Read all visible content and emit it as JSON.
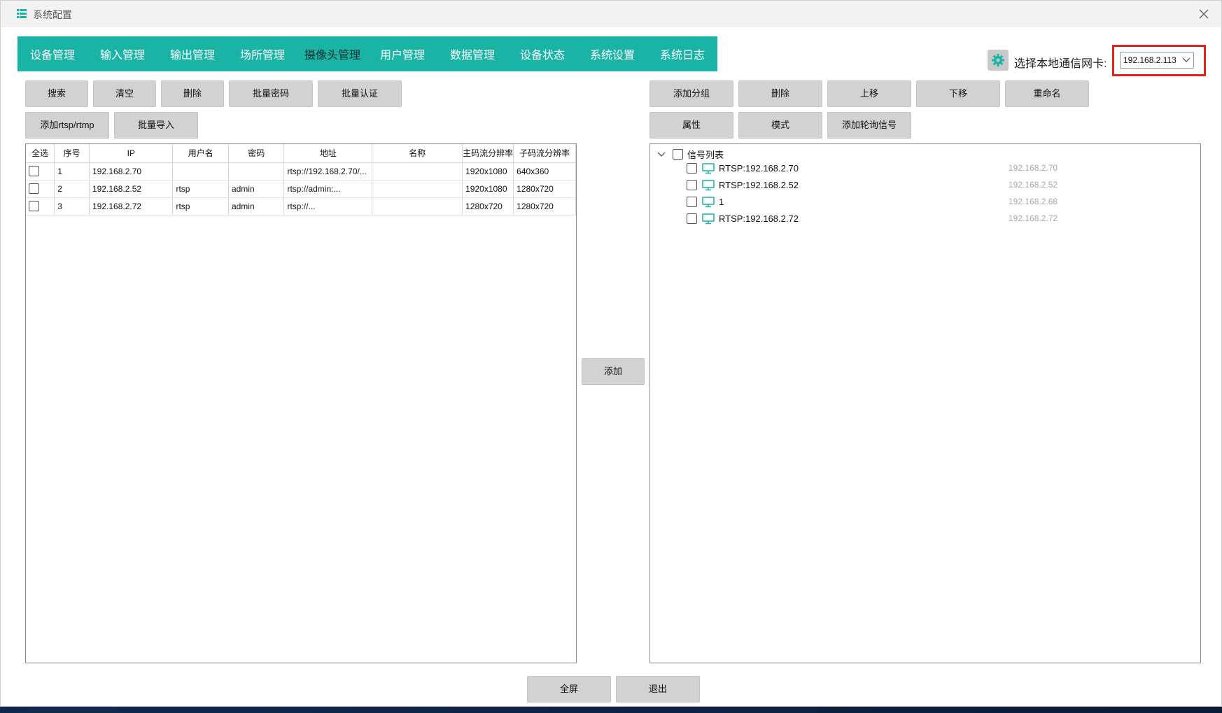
{
  "window": {
    "title": "系统配置"
  },
  "tabs": [
    "设备管理",
    "输入管理",
    "输出管理",
    "场所管理",
    "摄像头管理",
    "用户管理",
    "数据管理",
    "设备状态",
    "系统设置",
    "系统日志"
  ],
  "nic": {
    "label": "选择本地通信网卡:",
    "selected": "192.168.2.113"
  },
  "left_toolbar": {
    "row1": [
      "搜索",
      "清空",
      "删除",
      "批量密码",
      "批量认证"
    ],
    "row2": [
      "添加rtsp/rtmp",
      "批量导入"
    ]
  },
  "right_toolbar": {
    "row1": [
      "添加分组",
      "删除",
      "上移",
      "下移",
      "重命名"
    ],
    "row2": [
      "属性",
      "模式",
      "添加轮询信号"
    ]
  },
  "camera_table": {
    "headers": [
      "全选",
      "序号",
      "IP",
      "用户名",
      "密码",
      "地址",
      "名称",
      "主码流分辨率",
      "子码流分辨率"
    ],
    "rows": [
      {
        "index": "1",
        "ip": "192.168.2.70",
        "user": "",
        "password": "",
        "address": "rtsp://192.168.2.70/...",
        "name": "",
        "main_res": "1920x1080",
        "sub_res": "640x360"
      },
      {
        "index": "2",
        "ip": "192.168.2.52",
        "user": "rtsp",
        "password": "admin",
        "address": "rtsp://admin:...",
        "name": "",
        "main_res": "1920x1080",
        "sub_res": "1280x720"
      },
      {
        "index": "3",
        "ip": "192.168.2.72",
        "user": "rtsp",
        "password": "admin",
        "address": "rtsp://...",
        "name": "",
        "main_res": "1280x720",
        "sub_res": "1280x720"
      }
    ]
  },
  "add_button": "添加",
  "signal_tree": {
    "root": "信号列表",
    "items": [
      {
        "label": "RTSP:192.168.2.70",
        "ip": "192.168.2.70"
      },
      {
        "label": "RTSP:192.168.2.52",
        "ip": "192.168.2.52"
      },
      {
        "label": "1",
        "ip": "192.168.2.68"
      },
      {
        "label": "RTSP:192.168.2.72",
        "ip": "192.168.2.72"
      }
    ]
  },
  "footer": {
    "fullscreen": "全屏",
    "exit": "退出"
  },
  "colors": {
    "tab_bar": "#1ab4a6",
    "highlight": "#e8221b",
    "monitor_icon": "#1ab4a6"
  }
}
